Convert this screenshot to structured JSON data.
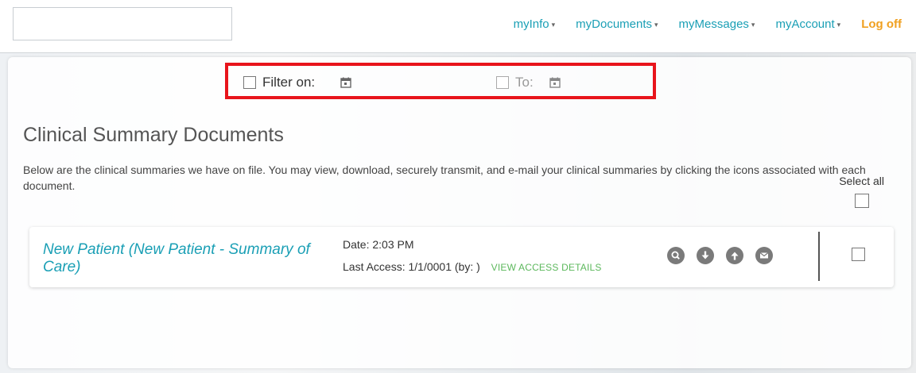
{
  "nav": {
    "items": [
      {
        "prefix": "my",
        "rest": "Info"
      },
      {
        "prefix": "my",
        "rest": "Documents"
      },
      {
        "prefix": "my",
        "rest": "Messages"
      },
      {
        "prefix": "my",
        "rest": "Account"
      }
    ],
    "logoff": "Log off"
  },
  "filter": {
    "filter_on_label": "Filter on:",
    "to_label": "To:"
  },
  "page": {
    "title": "Clinical Summary Documents",
    "description": "Below are the clinical summaries we have on file. You may view, download, securely transmit, and e-mail your clinical summaries by clicking the icons associated with each document.",
    "select_all": "Select all"
  },
  "document": {
    "title": "New Patient (New Patient - Summary of Care)",
    "date_label": "Date:",
    "date_value": "2:03 PM",
    "last_access_label": "Last Access:",
    "last_access_value": "1/1/0001 (by: )",
    "access_link": "VIEW ACCESS DETAILS"
  },
  "colors": {
    "accent": "#1a9fb5",
    "logoff": "#f0a020",
    "highlight_border": "#e8141b",
    "link_green": "#5cb85c"
  },
  "icons": [
    "calendar-icon",
    "search-icon",
    "download-icon",
    "upload-icon",
    "email-icon"
  ]
}
